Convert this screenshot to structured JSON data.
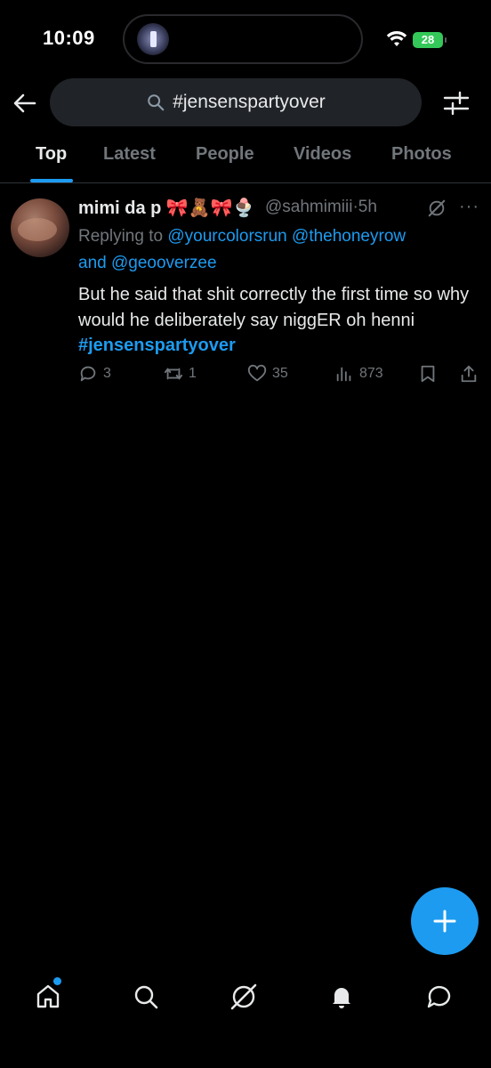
{
  "status_bar": {
    "time": "10:09",
    "battery": "28"
  },
  "search": {
    "query": "#jensenspartyover"
  },
  "tabs": [
    {
      "label": "Top",
      "active": true
    },
    {
      "label": "Latest",
      "active": false
    },
    {
      "label": "People",
      "active": false
    },
    {
      "label": "Videos",
      "active": false
    },
    {
      "label": "Photos",
      "active": false
    }
  ],
  "tweet": {
    "display_name": "mimi da p 🎀🧸🎀🍨",
    "handle": "@sahmimiii",
    "separator": "·",
    "time": "5h",
    "more": "···",
    "replying_prefix": "Replying to ",
    "mention_1": "@yourcolorsrun",
    "mention_2": "@thehoneyrow",
    "and_text": "and ",
    "mention_3": "@geooverzee",
    "text": "But he said that shit correctly the first time so why would he deliberately say niggER oh henni ",
    "hashtag": "#jensenspartyover",
    "replies": "3",
    "reposts": "1",
    "likes": "35",
    "views": "873"
  },
  "colors": {
    "accent": "#1d9bf0",
    "background": "#000000",
    "muted": "#71767b",
    "text": "#e7e9ea"
  },
  "icons": {
    "back": "arrow-left-icon",
    "search": "search-icon",
    "filter": "sliders-icon",
    "reply": "speech-bubble-icon",
    "repost": "repost-icon",
    "like": "heart-icon",
    "views": "bar-chart-icon",
    "bookmark": "bookmark-icon",
    "share": "share-icon",
    "compose": "plus-icon",
    "nav": [
      "home-icon",
      "search-icon",
      "grok-icon",
      "bell-icon",
      "messages-icon"
    ]
  }
}
